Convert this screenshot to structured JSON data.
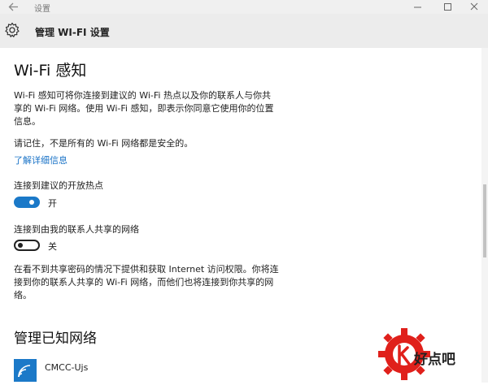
{
  "window": {
    "title": "设置"
  },
  "header": {
    "title": "管理 WI-FI 设置"
  },
  "main": {
    "heading": "Wi-Fi 感知",
    "description_line1": "Wi-Fi 感知可将你连接到建议的 Wi-Fi 热点以及你的联系人与你共",
    "description_line2": "享的 Wi-Fi 网络。使用 Wi-Fi 感知，即表示你同意它使用你的位置",
    "description_line3": "信息。",
    "warning": "请记住，不是所有的 Wi-Fi 网络都是安全的。",
    "learn_more": "了解详细信息",
    "toggle1": {
      "label": "连接到建议的开放热点",
      "state": "开",
      "on": true
    },
    "toggle2": {
      "label": "连接到由我的联系人共享的网络",
      "state": "关",
      "on": false
    },
    "info_line1": "在看不到共享密码的情况下提供和获取 Internet 访问权限。你将连",
    "info_line2": "接到你的联系人共享的 Wi-Fi 网络，而他们也将连接到你共享的网",
    "info_line3": "络。",
    "known_heading": "管理已知网络",
    "networks": [
      {
        "name": "CMCC-Ujs"
      }
    ]
  },
  "watermark": {
    "text": "好点吧"
  },
  "colors": {
    "accent": "#1b79c8",
    "header_bg": "#ececec",
    "titlebar_bg": "#f0f0f0",
    "watermark_red": "#e0201b"
  }
}
